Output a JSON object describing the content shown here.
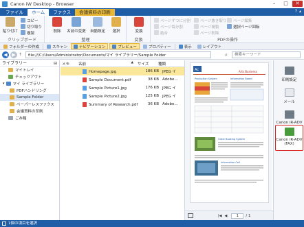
{
  "window": {
    "title": "Canon iW Desktop - Browser",
    "minimize": "–",
    "maximize": "□",
    "close": "✕"
  },
  "ribbon_tabs": [
    "ファイル",
    "ホーム",
    "ファクス",
    "会議資料の印刷"
  ],
  "ribbon_help": [
    "?",
    "▴"
  ],
  "ribbon": {
    "clipboard": {
      "label": "クリップボード",
      "paste": "貼り付け",
      "copy": "コピー",
      "cut": "切り取り",
      "duplicate": "複製"
    },
    "organize": {
      "label": "整理",
      "delete": "削除",
      "rename": "名前の変更",
      "auto_rename": "自動設定",
      "select": "選択"
    },
    "convert": {
      "label": "変換",
      "convert": "変換"
    },
    "pdf_ops": {
      "label": "PDFの操作",
      "split_page": "ページずつに分割",
      "split_pages": "ページ毎分割",
      "combine": "結合",
      "page_extract": "ページ抜き取り",
      "page_copy": "ページ複製",
      "page_delete": "ページ削除",
      "page_edit": "ページ編集",
      "select_pages": "選択ページ回転"
    }
  },
  "toolbar": {
    "new_folder": "フォルダーの作成",
    "scan": "スキャン",
    "navigation": "ナビゲーション",
    "preview": "プレビュー",
    "properties": "プロパティー",
    "view": "表示",
    "layout": "レイアウト"
  },
  "address": {
    "path": "file:///C:/Users/Administrator/Documents/マイ ライブラリー/Sample Folder",
    "search_placeholder": "検索キーワード",
    "back": "◀",
    "forward": "▶",
    "up": "↑"
  },
  "sidebar": {
    "header": "ライブラリー",
    "pin": "⊟",
    "items": [
      {
        "label": "マイトレイ",
        "indent": 1
      },
      {
        "label": "チェックアウト",
        "indent": 1
      },
      {
        "label": "マイ ライブラリー",
        "indent": 0
      },
      {
        "label": "PDFハンドリング",
        "indent": 2
      },
      {
        "label": "Sample Folder",
        "indent": 2
      },
      {
        "label": "ペーパーレスファクス",
        "indent": 2
      },
      {
        "label": "会議資料の印刷",
        "indent": 2
      },
      {
        "label": "ごみ箱",
        "indent": 1
      }
    ]
  },
  "filelist": {
    "columns": [
      "メモ",
      "名前",
      "サイズ",
      "種類"
    ],
    "sort_indicator": "▲",
    "rows": [
      {
        "name": "Homepage.jpg",
        "size": "186 KB",
        "type": "JPEG イ",
        "kind": "jpg"
      },
      {
        "name": "Sample Document.pdf",
        "size": "38 KB",
        "type": "Adobe...",
        "kind": "pdf"
      },
      {
        "name": "Sample Picture1.jpg",
        "size": "176 KB",
        "type": "JPEG イ",
        "kind": "jpg"
      },
      {
        "name": "Sample Picture2.jpg",
        "size": "125 KB",
        "type": "JPEG イ",
        "kind": "jpg"
      },
      {
        "name": "Summary of Research.pdf",
        "size": "36 KB",
        "type": "Adobe...",
        "kind": "pdf"
      }
    ]
  },
  "preview": {
    "page_current": "1",
    "page_total": "/ 1",
    "doc_heading": "Arts Business",
    "section1": "Production System",
    "section2": "Information Board",
    "section3": "Order Booking System",
    "section4": "Information Cell",
    "logo": "Ac"
  },
  "rightpanel": {
    "print_settings": "印刷設定",
    "mail": "メール",
    "canon_adv": "Canon iR-ADV",
    "canon_adv_fax": "Canon iR-ADV (FAX)"
  },
  "status": "1個の項目を選択",
  "colors": {
    "accent": "#1f5da6",
    "selection": "#fbe79a",
    "highlight_border": "#d8231e"
  }
}
